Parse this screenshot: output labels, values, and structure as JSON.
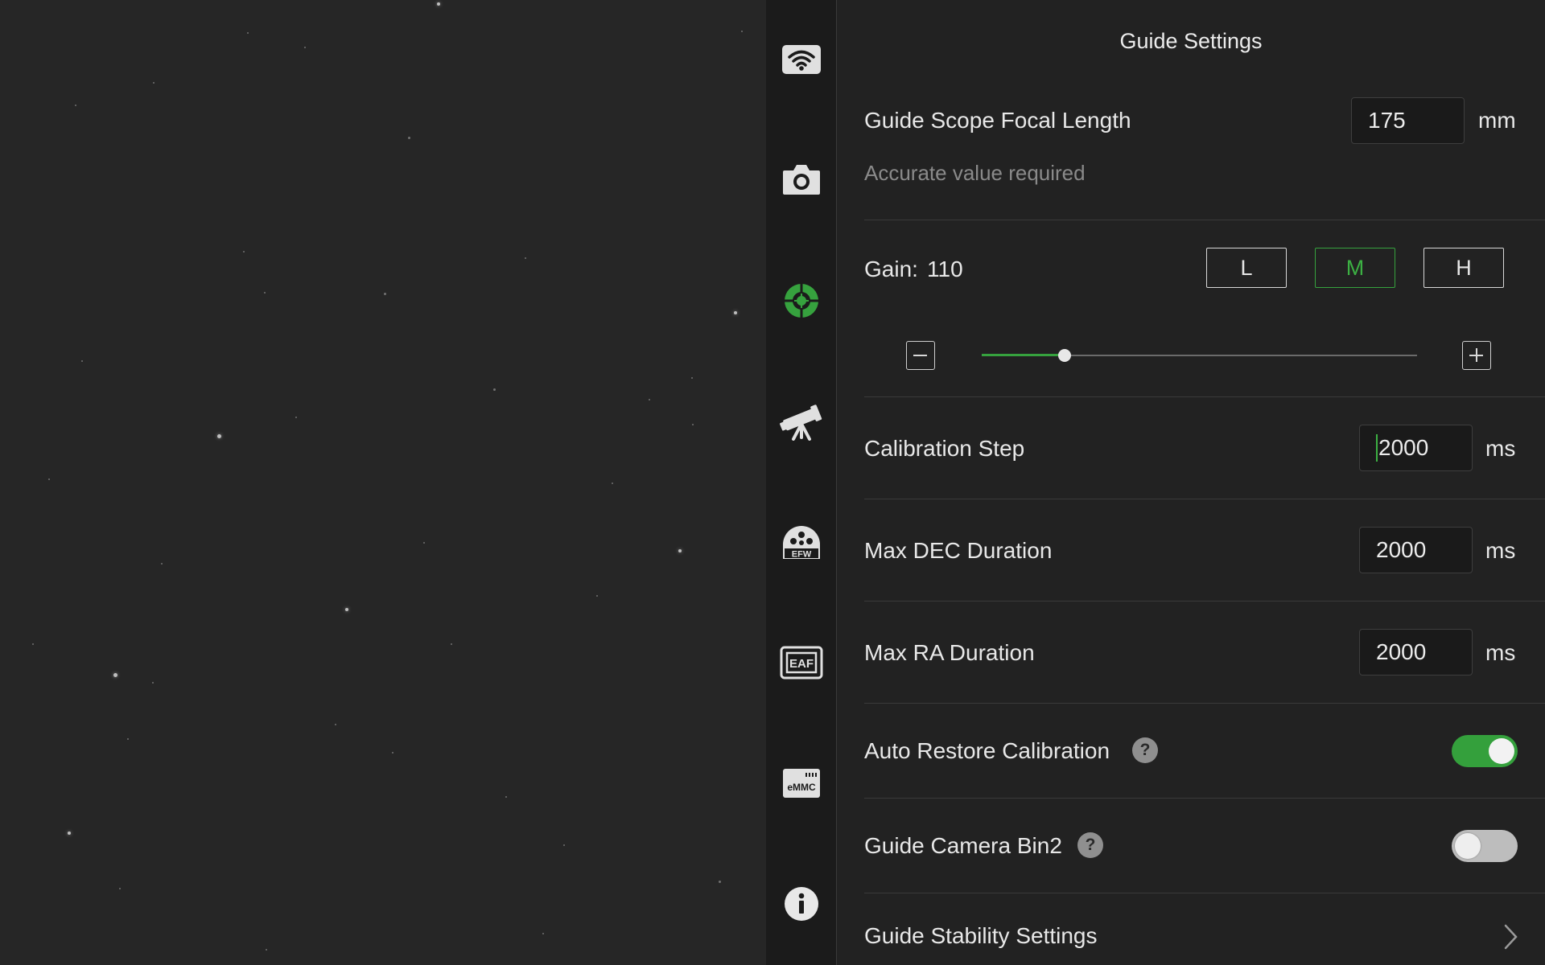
{
  "sidebar": {
    "items": [
      {
        "icon": "wifi-icon"
      },
      {
        "icon": "camera-icon"
      },
      {
        "icon": "guide-target-icon",
        "active": true
      },
      {
        "icon": "telescope-icon"
      },
      {
        "icon": "efw-icon",
        "text": "EFW"
      },
      {
        "icon": "eaf-icon",
        "text": "EAF"
      },
      {
        "icon": "emmc-icon",
        "text": "eMMC"
      },
      {
        "icon": "info-icon"
      }
    ]
  },
  "panel": {
    "title": "Guide Settings",
    "focal_length": {
      "label": "Guide Scope Focal Length",
      "value": "175",
      "unit": "mm",
      "hint": "Accurate value required"
    },
    "gain": {
      "label": "Gain:",
      "value": "110",
      "presets": [
        "L",
        "M",
        "H"
      ],
      "selected_preset": "M",
      "slider_fraction": 0.19
    },
    "calibration_step": {
      "label": "Calibration Step",
      "value": "2000",
      "unit": "ms"
    },
    "max_dec": {
      "label": "Max DEC Duration",
      "value": "2000",
      "unit": "ms"
    },
    "max_ra": {
      "label": "Max RA Duration",
      "value": "2000",
      "unit": "ms"
    },
    "auto_restore": {
      "label": "Auto Restore Calibration",
      "help": "?",
      "enabled": true
    },
    "bin2": {
      "label": "Guide Camera Bin2",
      "help": "?",
      "enabled": false
    },
    "stability": {
      "label": "Guide Stability Settings"
    }
  },
  "colors": {
    "accent": "#3cb043",
    "background": "#222222",
    "sidebar": "#1b1b1b"
  }
}
